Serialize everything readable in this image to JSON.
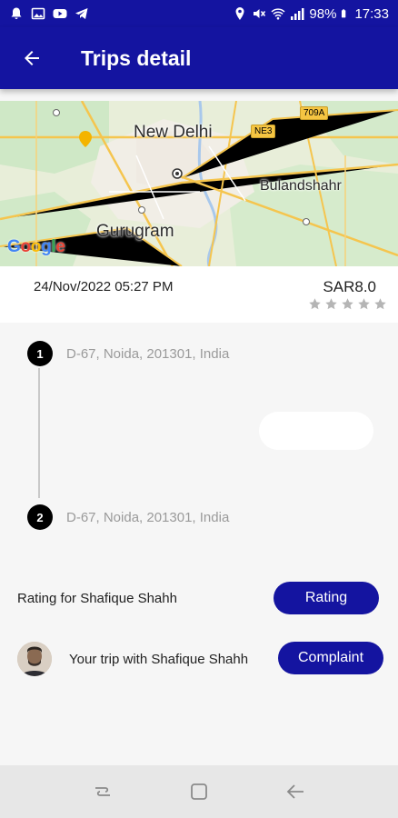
{
  "status_bar": {
    "battery": "98%",
    "time": "17:33",
    "icons_left": [
      "notification-bell-icon",
      "gallery-icon",
      "youtube-icon",
      "telegram-icon"
    ],
    "icons_right": [
      "location-icon",
      "mute-icon",
      "wifi-icon",
      "signal-icon",
      "battery-icon"
    ]
  },
  "header": {
    "title": "Trips detail"
  },
  "map": {
    "labels": {
      "city_1": "New Delhi",
      "city_2": "Gurugram",
      "city_3": "Bulandshahr",
      "shield_1": "NE3",
      "shield_2": "709A",
      "logo": "Google"
    }
  },
  "trip": {
    "date": "24/Nov/2022 05:27 PM",
    "fare": "SAR8.0",
    "rating_stars": 0,
    "rating_max": 5,
    "stops": [
      {
        "num": "1",
        "address": "D-67, Noida, 201301, India"
      },
      {
        "num": "2",
        "address": "D-67, Noida, 201301, India"
      }
    ]
  },
  "actions": {
    "rating_text": "Rating for Shafique  Shahh",
    "rating_button": "Rating",
    "trip_text": "Your trip with Shafique  Shahh",
    "complaint_button": "Complaint"
  },
  "colors": {
    "primary": "#1414a0",
    "star_empty": "#b5b5b5"
  }
}
